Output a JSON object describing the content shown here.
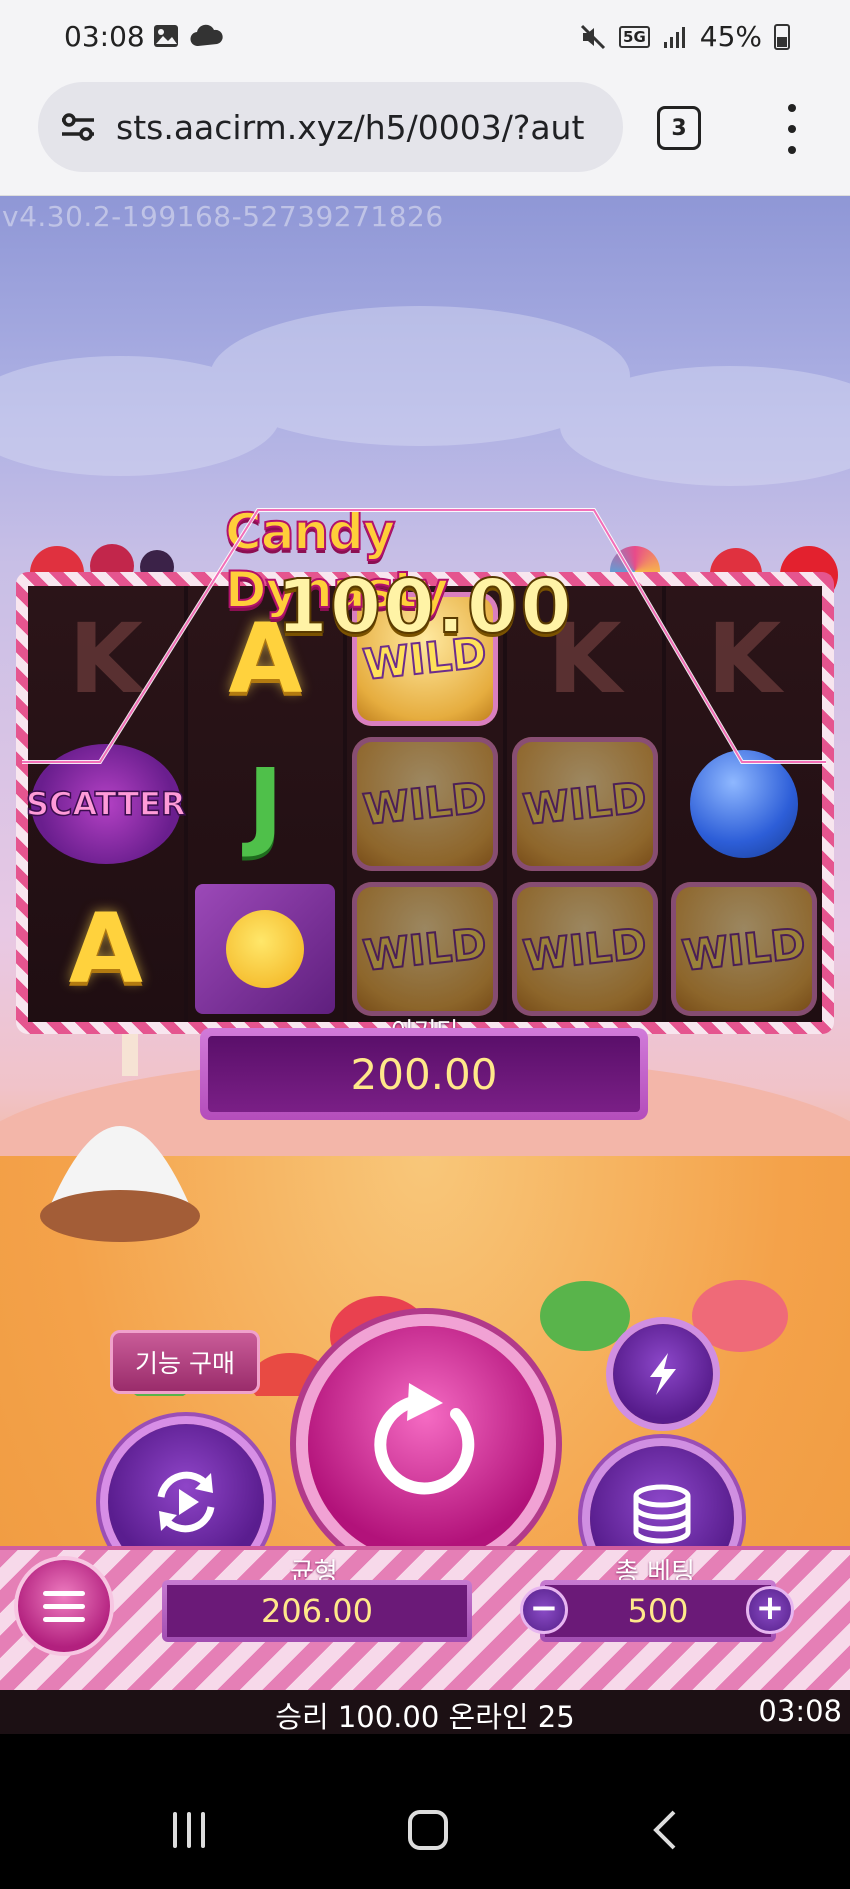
{
  "status_bar": {
    "time": "03:08",
    "battery": "45%",
    "network": "5G",
    "icons": [
      "image-icon",
      "cloud-icon",
      "mute-icon",
      "signal-icon",
      "battery-icon"
    ]
  },
  "browser": {
    "url": "sts.aacirm.xyz/h5/0003/?aut",
    "tab_count": "3"
  },
  "game": {
    "version": "v4.30.2-199168-52739271826",
    "logo": "Candy Dynasty",
    "reels": [
      [
        "K",
        "SCATTER",
        "A"
      ],
      [
        "A",
        "J",
        "M&M"
      ],
      [
        "WILD",
        "WILD",
        "WILD"
      ],
      [
        "K",
        "WILD",
        "WILD"
      ],
      [
        "K",
        "BLUE",
        "WILD"
      ]
    ],
    "line_win": "100.00",
    "win_label": "이기다",
    "win_value": "200.00",
    "buy_feature_label": "기능 구매",
    "balance_label": "균형",
    "balance_value": "206.00",
    "total_bet_label": "총 베팅",
    "total_bet_value": "500",
    "bet_minus": "−",
    "bet_plus": "+",
    "footer_message": "승리 100.00 온라인 25",
    "footer_time": "03:08"
  },
  "colors": {
    "win_text": "#ffe88a",
    "panel_purple": "#6b1a78",
    "accent_pink": "#e57fb6"
  }
}
